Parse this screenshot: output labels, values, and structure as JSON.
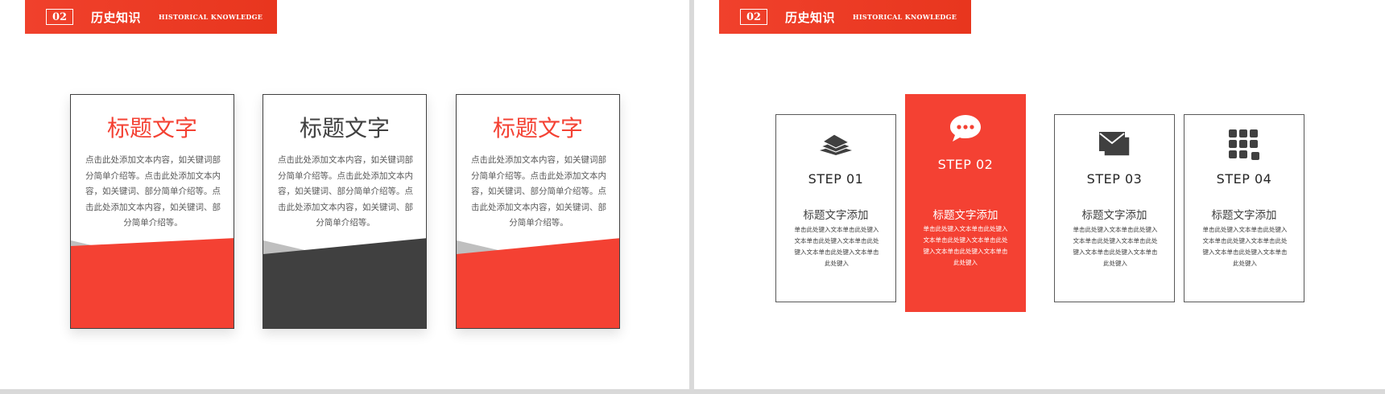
{
  "left_slide": {
    "header": {
      "number": "02",
      "title": "历史知识",
      "subtitle": "HISTORICAL KNOWLEDGE"
    },
    "cards": [
      {
        "title": "标题文字",
        "title_color": "#f44133",
        "bottom_color": "#f44133",
        "body": "点击此处添加文本内容，如关键词部分简单介绍等。点击此处添加文本内容，如关键词、部分简单介绍等。点击此处添加文本内容，如关键词、部分简单介绍等。"
      },
      {
        "title": "标题文字",
        "title_color": "#404040",
        "bottom_color": "#404040",
        "body": "点击此处添加文本内容，如关键词部分简单介绍等。点击此处添加文本内容，如关键词、部分简单介绍等。点击此处添加文本内容，如关键词、部分简单介绍等。"
      },
      {
        "title": "标题文字",
        "title_color": "#f44133",
        "bottom_color": "#f44133",
        "body": "点击此处添加文本内容，如关键词部分简单介绍等。点击此处添加文本内容，如关键词、部分简单介绍等。点击此处添加文本内容，如关键词、部分简单介绍等。"
      }
    ]
  },
  "right_slide": {
    "header": {
      "number": "02",
      "title": "历史知识",
      "subtitle": "HISTORICAL KNOWLEDGE"
    },
    "steps": [
      {
        "label": "STEP 01",
        "subtitle": "标题文字添加",
        "body": "单击此处键入文本单击此处键入文本单击此处键入文本单击此处键入文本单击此处键入文本单击此处键入",
        "icon": "papers-icon",
        "active": false
      },
      {
        "label": "STEP 02",
        "subtitle": "标题文字添加",
        "body": "单击此处键入文本单击此处键入文本单击此处键入文本单击此处键入文本单击此处键入文本单击此处键入",
        "icon": "chat-bubble-icon",
        "active": true
      },
      {
        "label": "STEP 03",
        "subtitle": "标题文字添加",
        "body": "单击此处键入文本单击此处键入文本单击此处键入文本单击此处键入文本单击此处键入文本单击此处键入",
        "icon": "envelopes-icon",
        "active": false
      },
      {
        "label": "STEP 04",
        "subtitle": "标题文字添加",
        "body": "单击此处键入文本单击此处键入文本单击此处键入文本单击此处键入文本单击此处键入文本单击此处键入",
        "icon": "grid-apps-icon",
        "active": false
      }
    ]
  },
  "colors": {
    "accent": "#f44133",
    "dark": "#404040"
  }
}
